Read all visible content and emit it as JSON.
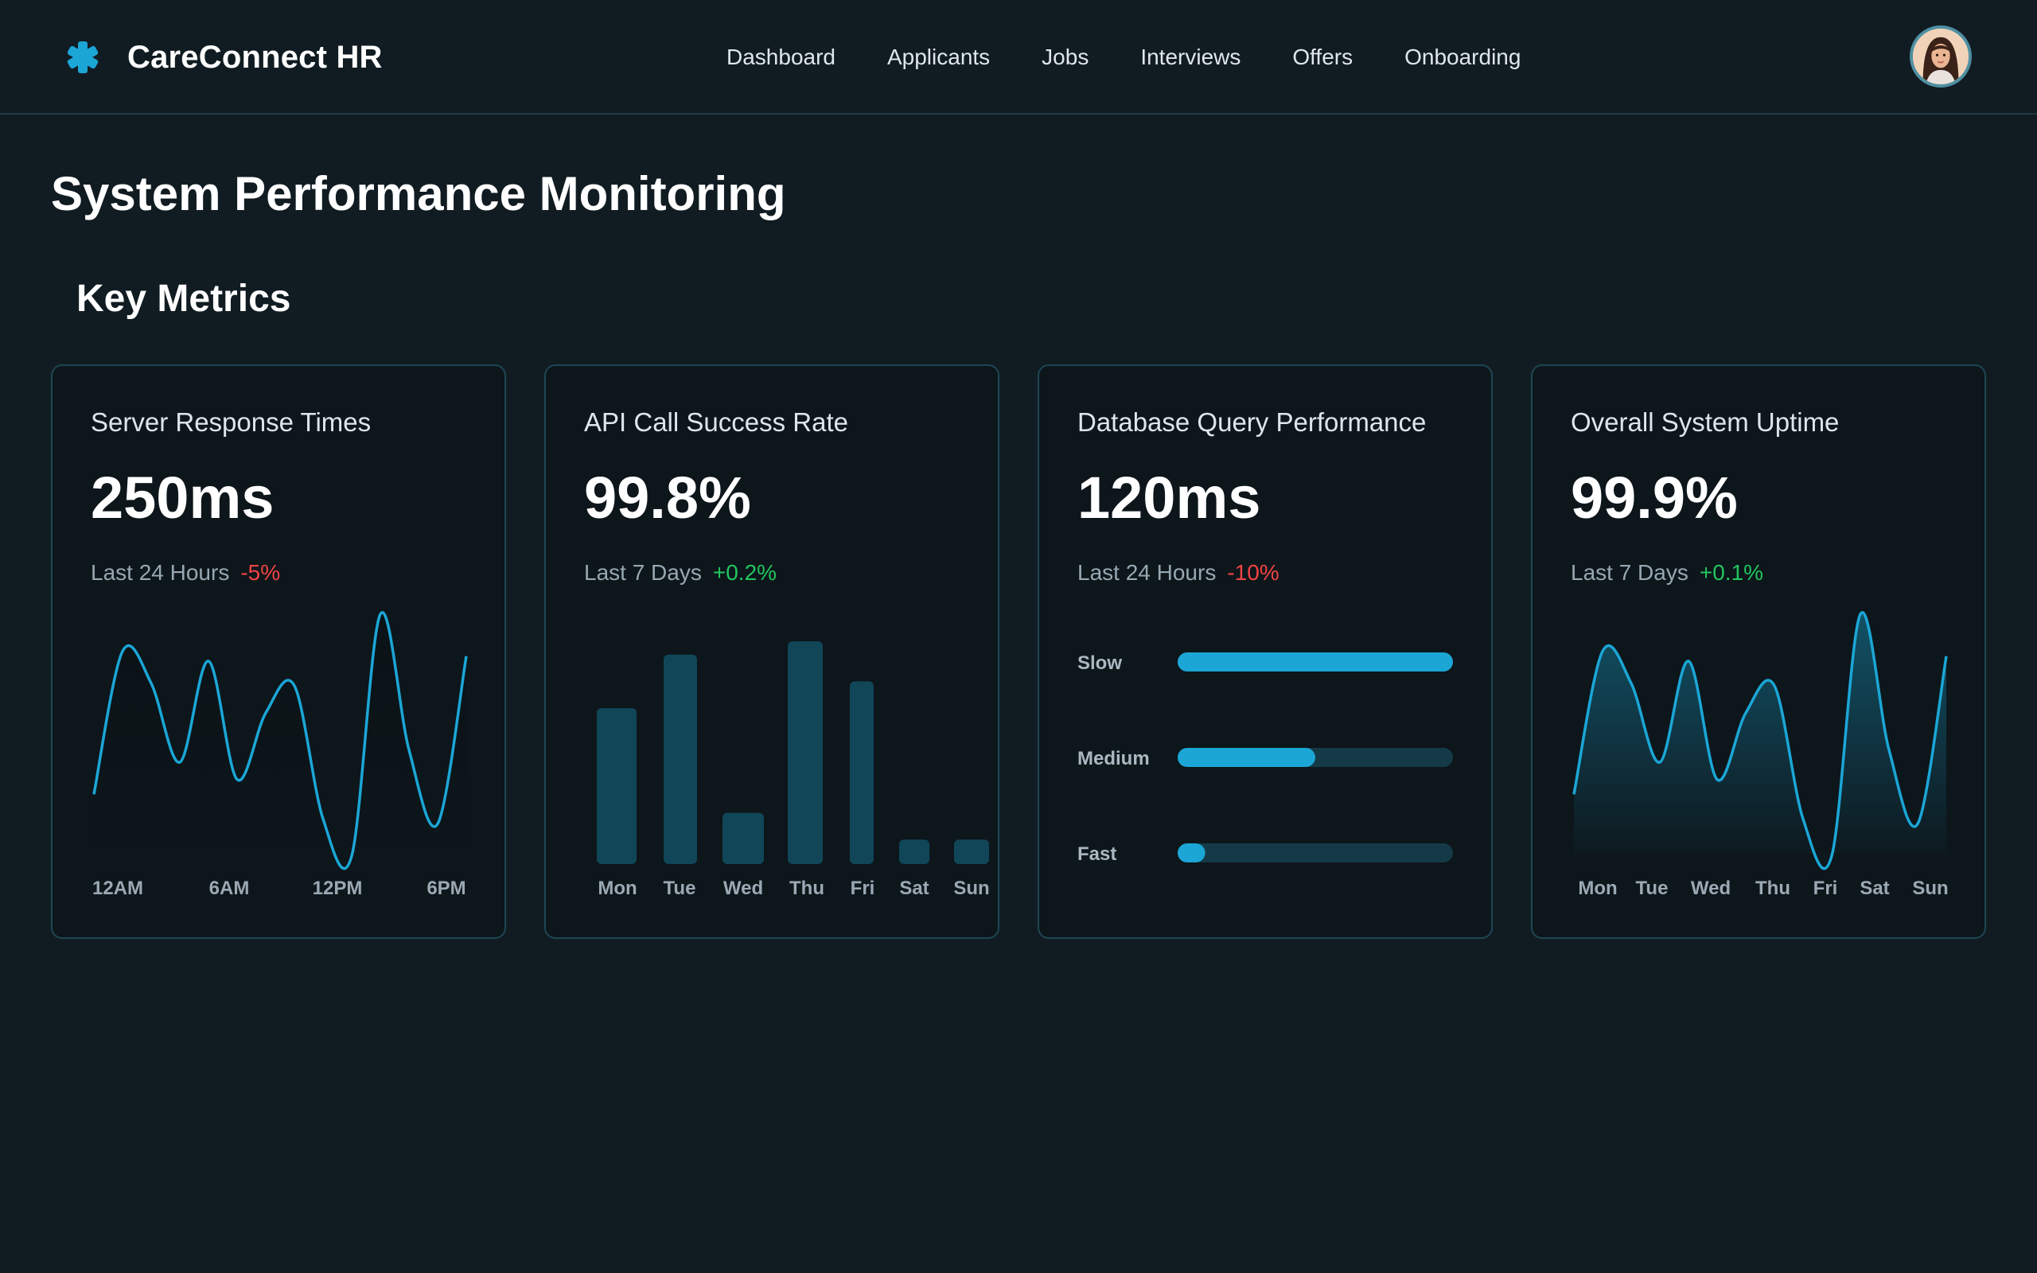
{
  "app": {
    "name": "CareConnect HR"
  },
  "nav": {
    "items": [
      {
        "label": "Dashboard"
      },
      {
        "label": "Applicants"
      },
      {
        "label": "Jobs"
      },
      {
        "label": "Interviews"
      },
      {
        "label": "Offers"
      },
      {
        "label": "Onboarding"
      }
    ]
  },
  "icons": {
    "brand": "medical-asterisk-icon",
    "avatar": "user-avatar"
  },
  "colors": {
    "background": "#111c22",
    "card": "#0d161b",
    "accent": "#1ba6d6",
    "bar": "#104658",
    "negative": "#ef4444",
    "positive": "#22c55e"
  },
  "page": {
    "title": "System Performance Monitoring"
  },
  "section": {
    "title": "Key Metrics"
  },
  "cards": [
    {
      "title": "Server Response Times",
      "value": "250ms",
      "period": "Last 24 Hours",
      "change": "-5%"
    },
    {
      "title": "API Call Success Rate",
      "value": "99.8%",
      "period": "Last 7 Days",
      "change": "+0.2%"
    },
    {
      "title": "Database Query Performance",
      "value": "120ms",
      "period": "Last 24 Hours",
      "change": "-10%"
    },
    {
      "title": "Overall System Uptime",
      "value": "99.9%",
      "period": "Last 7 Days",
      "change": "+0.1%"
    }
  ],
  "chart_data": [
    {
      "type": "line",
      "x_ticks": [
        "12AM",
        "6AM",
        "12PM",
        "6PM"
      ],
      "y_relative": [
        0.27,
        0.85,
        0.72,
        0.4,
        0.81,
        0.33,
        0.6,
        0.71,
        0.17,
        0.02,
        1.0,
        0.45,
        0.15,
        0.83
      ],
      "grid": false,
      "area_fill": "faint"
    },
    {
      "type": "bar",
      "categories": [
        "Mon",
        "Tue",
        "Wed",
        "Thu",
        "Fri",
        "Sat",
        "Sun"
      ],
      "values": [
        0.7,
        0.94,
        0.23,
        1.0,
        0.82,
        0.11,
        0.11
      ],
      "grid": false
    },
    {
      "type": "bar",
      "orientation": "horizontal",
      "categories": [
        "Slow",
        "Medium",
        "Fast"
      ],
      "values": [
        1.0,
        0.5,
        0.1
      ],
      "range": [
        0,
        1
      ]
    },
    {
      "type": "area",
      "categories": [
        "Mon",
        "Tue",
        "Wed",
        "Thu",
        "Fri",
        "Sat",
        "Sun"
      ],
      "y_relative": [
        0.27,
        0.85,
        0.72,
        0.4,
        0.81,
        0.33,
        0.6,
        0.71,
        0.17,
        0.02,
        1.0,
        0.45,
        0.15,
        0.83
      ],
      "grid": false
    }
  ]
}
